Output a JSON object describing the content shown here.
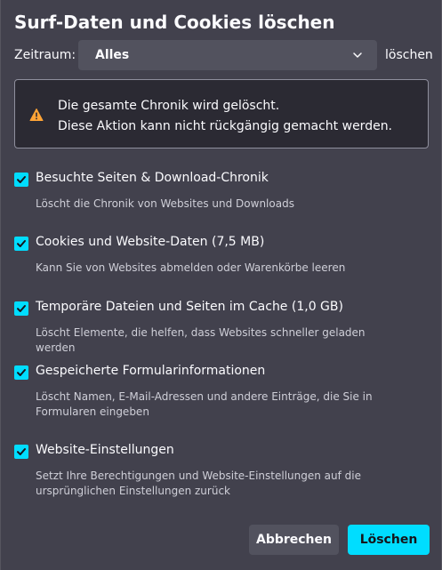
{
  "dialog": {
    "title": "Surf-Daten und Cookies löschen"
  },
  "time_range": {
    "label": "Zeitraum:",
    "selected": "Alles",
    "suffix": "löschen"
  },
  "warning": {
    "icon": "warning-triangle-icon",
    "line1": "Die gesamte Chronik wird gelöscht.",
    "line2": "Diese Aktion kann nicht rückgängig gemacht werden."
  },
  "options": [
    {
      "label": "Besuchte Seiten & Download-Chronik",
      "description": "Löscht die Chronik von Websites und Downloads",
      "checked": true
    },
    {
      "label": "Cookies und Website-Daten (7,5 MB)",
      "description": "Kann Sie von Websites abmelden oder Warenkörbe leeren",
      "checked": true
    },
    {
      "label": "Temporäre Dateien und Seiten im Cache (1,0 GB)",
      "description": "Löscht Elemente, die helfen, dass Websites schneller geladen werden",
      "checked": true
    },
    {
      "label": "Gespeicherte Formularinformationen",
      "description": "Löscht Namen, E-Mail-Adressen und andere Einträge, die Sie in Formularen eingeben",
      "checked": true
    },
    {
      "label": "Website-Einstellungen",
      "description": "Setzt Ihre Berechtigungen und Website-Einstellungen auf die ursprünglichen Einstellungen zurück",
      "checked": true
    }
  ],
  "buttons": {
    "cancel": "Abbrechen",
    "confirm": "Löschen"
  },
  "colors": {
    "background": "#42414d",
    "accent": "#00ddff",
    "warning": "#ffa436",
    "panel": "#2b2a33"
  }
}
